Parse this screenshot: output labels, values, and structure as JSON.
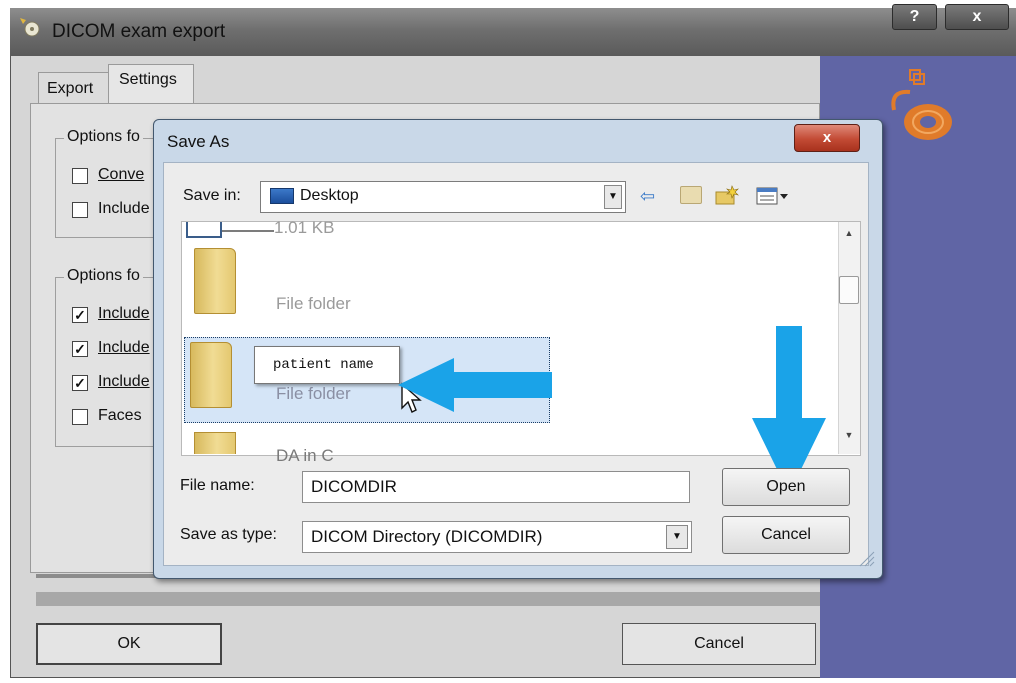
{
  "window": {
    "title": "DICOM exam export",
    "help_label": "?",
    "close_label": "x"
  },
  "tabs": [
    {
      "label": "Export"
    },
    {
      "label": "Settings"
    }
  ],
  "settings": {
    "group1": {
      "label": "Options fo",
      "items": [
        {
          "label": "Conve",
          "checked": false
        },
        {
          "label": "Include",
          "checked": false
        }
      ]
    },
    "group2": {
      "label": "Options fo",
      "items": [
        {
          "label": "Include",
          "checked": true
        },
        {
          "label": "Include",
          "checked": true
        },
        {
          "label": "Include",
          "checked": true
        },
        {
          "label": "Faces",
          "checked": false
        }
      ]
    }
  },
  "footer": {
    "ok_label": "OK",
    "cancel_label": "Cancel"
  },
  "save_dialog": {
    "title": "Save As",
    "close_label": "x",
    "save_in_label": "Save in:",
    "save_in_value": "Desktop",
    "files": [
      {
        "detail": "1.01 KB"
      },
      {
        "detail": "File folder"
      },
      {
        "name": "patient name",
        "detail": "File folder"
      },
      {
        "detail": "DA in C"
      }
    ],
    "file_name_label": "File name:",
    "file_name_value": "DICOMDIR",
    "save_as_type_label": "Save as type:",
    "save_as_type_value": "DICOM Directory (DICOMDIR)",
    "open_label": "Open",
    "cancel_label": "Cancel"
  },
  "colors": {
    "accent_panel": "#6065a5",
    "arrow_highlight": "#1aa3e8",
    "selection": "#d5e5f7"
  }
}
